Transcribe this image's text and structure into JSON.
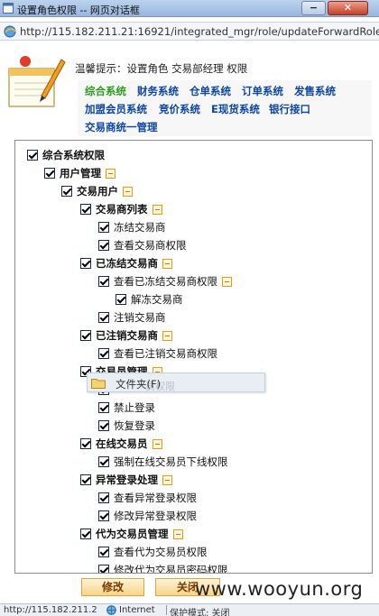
{
  "window": {
    "title": "设置角色权限 -- 网页对话框",
    "min_label": "−",
    "close_label": "✕",
    "url": "http://115.182.211.21:16921/integrated_mgr/role/updateForwardRole"
  },
  "header": {
    "notice": "温馨提示：设置角色 交易部经理 权限",
    "nav": [
      {
        "label": "综合系统",
        "active": true
      },
      {
        "label": "财务系统",
        "active": false
      },
      {
        "label": "仓单系统",
        "active": false
      },
      {
        "label": "订单系统",
        "active": false
      },
      {
        "label": "发售系统",
        "active": false
      },
      {
        "label": "加盟会员系统",
        "active": false
      },
      {
        "label": "竞价系统",
        "active": false
      },
      {
        "label": "E现货系统",
        "active": false
      },
      {
        "label": "银行接口",
        "active": false
      },
      {
        "label": "交易商统一管理",
        "active": false
      }
    ]
  },
  "tree": [
    {
      "label": "综合系统权限",
      "level": 0,
      "bold": true,
      "checked": true,
      "toggle": false
    },
    {
      "label": "用户管理",
      "level": 1,
      "bold": true,
      "checked": true,
      "toggle": true
    },
    {
      "label": "交易用户",
      "level": 2,
      "bold": true,
      "checked": true,
      "toggle": true
    },
    {
      "label": "交易商列表",
      "level": 3,
      "bold": true,
      "checked": true,
      "toggle": true
    },
    {
      "label": "冻结交易商",
      "level": 4,
      "bold": false,
      "checked": true,
      "toggle": false
    },
    {
      "label": "查看交易商权限",
      "level": 4,
      "bold": false,
      "checked": true,
      "toggle": false
    },
    {
      "label": "已冻结交易商",
      "level": 3,
      "bold": true,
      "checked": true,
      "toggle": true
    },
    {
      "label": "查看已冻结交易商权限",
      "level": 4,
      "bold": false,
      "checked": true,
      "toggle": true
    },
    {
      "label": "解冻交易商",
      "level": 5,
      "bold": false,
      "checked": true,
      "toggle": false
    },
    {
      "label": "注销交易商",
      "level": 4,
      "bold": false,
      "checked": true,
      "toggle": false
    },
    {
      "label": "已注销交易商",
      "level": 3,
      "bold": true,
      "checked": true,
      "toggle": true
    },
    {
      "label": "查看已注销交易商权限",
      "level": 4,
      "bold": false,
      "checked": true,
      "toggle": false
    },
    {
      "label": "交易员管理",
      "level": 3,
      "bold": true,
      "checked": true,
      "toggle": true
    },
    {
      "label": "",
      "level": 4,
      "bold": false,
      "checked": true,
      "toggle": false
    },
    {
      "label": "禁止登录",
      "level": 4,
      "bold": false,
      "checked": true,
      "toggle": false
    },
    {
      "label": "恢复登录",
      "level": 4,
      "bold": false,
      "checked": true,
      "toggle": false
    },
    {
      "label": "在线交易员",
      "level": 3,
      "bold": true,
      "checked": true,
      "toggle": true
    },
    {
      "label": "强制在线交易员下线权限",
      "level": 4,
      "bold": false,
      "checked": true,
      "toggle": false
    },
    {
      "label": "异常登录处理",
      "level": 3,
      "bold": true,
      "checked": true,
      "toggle": true
    },
    {
      "label": "查看异常登录权限",
      "level": 4,
      "bold": false,
      "checked": true,
      "toggle": false
    },
    {
      "label": "修改异常登录权限",
      "level": 4,
      "bold": false,
      "checked": true,
      "toggle": false
    },
    {
      "label": "代为交易员管理",
      "level": 3,
      "bold": true,
      "checked": true,
      "toggle": true
    },
    {
      "label": "查看代为交易员权限",
      "level": 4,
      "bold": false,
      "checked": true,
      "toggle": false
    },
    {
      "label": "修改代为交易员密码权限",
      "level": 4,
      "bold": false,
      "checked": true,
      "toggle": false
    }
  ],
  "overlay": {
    "text": "文件夹(F)",
    "ghost": "员权限"
  },
  "buttons": {
    "modify": "修改",
    "close": "关闭"
  },
  "watermark": "www.wooyun.org",
  "status": {
    "url": "http://115.182.211.2",
    "zone": "Internet",
    "protect": "保护模式: 关闭"
  },
  "colors": {
    "nav_link": "#0d47a1",
    "nav_active": "#2e9b1e",
    "toggle_border": "#e89a18",
    "button_text": "#7a3b00"
  }
}
